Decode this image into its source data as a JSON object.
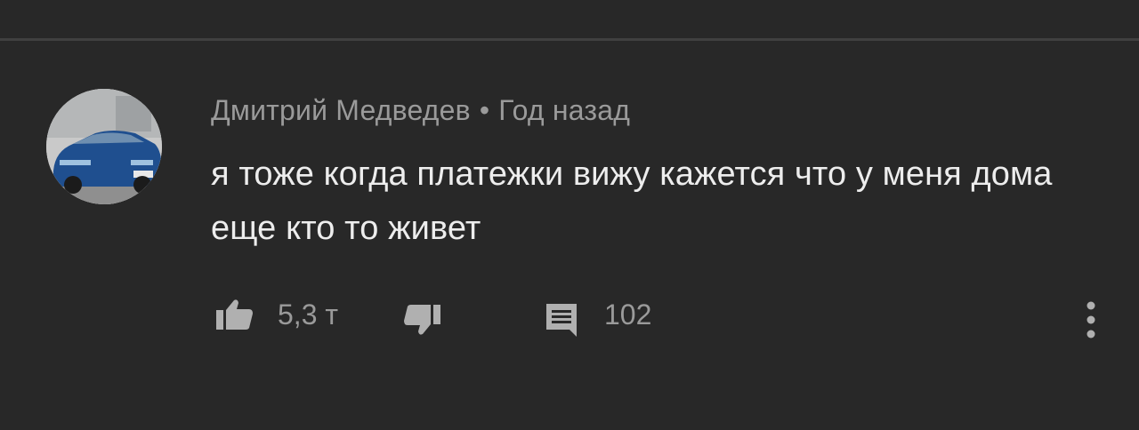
{
  "comment": {
    "author": "Дмитрий Медведев",
    "separator": "•",
    "time": "Год назад",
    "text": "я тоже когда платежки вижу кажется что у меня дома еще кто то живет",
    "likes": "5,3 т",
    "replies": "102"
  },
  "icons": {
    "like": "thumb-up-icon",
    "dislike": "thumb-down-icon",
    "reply": "comment-icon",
    "more": "more-vertical-icon"
  },
  "colors": {
    "background": "#282828",
    "divider": "#404040",
    "primary_text": "#ededed",
    "secondary_text": "#9a9a9a"
  }
}
